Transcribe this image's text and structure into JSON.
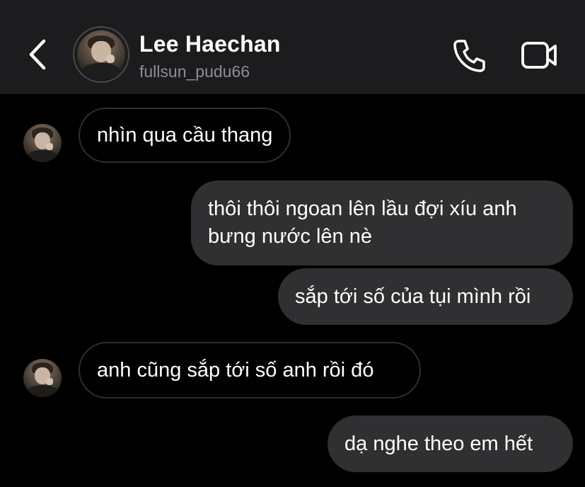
{
  "header": {
    "contact_name": "Lee Haechan",
    "username": "fullsun_pudu66",
    "back_icon": "chevron-left-icon",
    "call_icon": "phone-icon",
    "video_icon": "video-camera-icon"
  },
  "messages": [
    {
      "direction": "incoming",
      "text": "nhìn qua cầu thang"
    },
    {
      "direction": "outgoing",
      "text": "thôi thôi ngoan lên lầu đợi xíu anh bưng nước lên nè"
    },
    {
      "direction": "outgoing",
      "text": "sắp tới số của tụi mình rồi"
    },
    {
      "direction": "incoming",
      "text": "anh cũng sắp tới số anh rồi đó"
    },
    {
      "direction": "outgoing",
      "text": "dạ nghe theo em hết"
    }
  ],
  "colors": {
    "background": "#000000",
    "header_bg": "#1c1c1e",
    "outgoing_bubble": "#303032",
    "incoming_border": "#2f2f31",
    "muted_text": "#8e8e93"
  }
}
